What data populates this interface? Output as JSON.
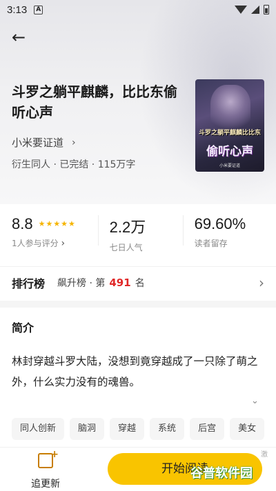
{
  "status_bar": {
    "time": "3:13",
    "notification_icon": "A"
  },
  "book": {
    "title": "斗罗之躺平麒麟，比比东偷听心声",
    "author": "小米要证道",
    "meta": "衍生同人 · 已完结 · 115万字",
    "cover": {
      "line1": "斗罗之躺平麒麟比比东",
      "line2": "偷听心声",
      "line3": "小米要证道"
    }
  },
  "stats": {
    "rating": {
      "value": "8.8",
      "label": "1人参与评分",
      "stars": "★★★★★"
    },
    "weekly": {
      "value": "2.2万",
      "label": "七日人气"
    },
    "retention": {
      "value": "69.60%",
      "label": "读者留存"
    }
  },
  "ranking": {
    "title": "排行榜",
    "name": "飙升榜 · 第",
    "number": "491",
    "suffix": "名"
  },
  "synopsis": {
    "title": "简介",
    "text": "林封穿越斗罗大陆，没想到竟穿越成了一只除了萌之外，什么实力没有的魂兽。"
  },
  "tags": [
    "同人创新",
    "脑洞",
    "穿越",
    "系统",
    "后宫",
    "美女"
  ],
  "bottom": {
    "follow_label": "追更新",
    "start_label": "开始阅读"
  },
  "watermark": {
    "text": "谷普软件园",
    "corner": "激"
  },
  "colors": {
    "accent": "#f9c400",
    "rank_number": "#e02828",
    "stars": "#f5b400"
  }
}
